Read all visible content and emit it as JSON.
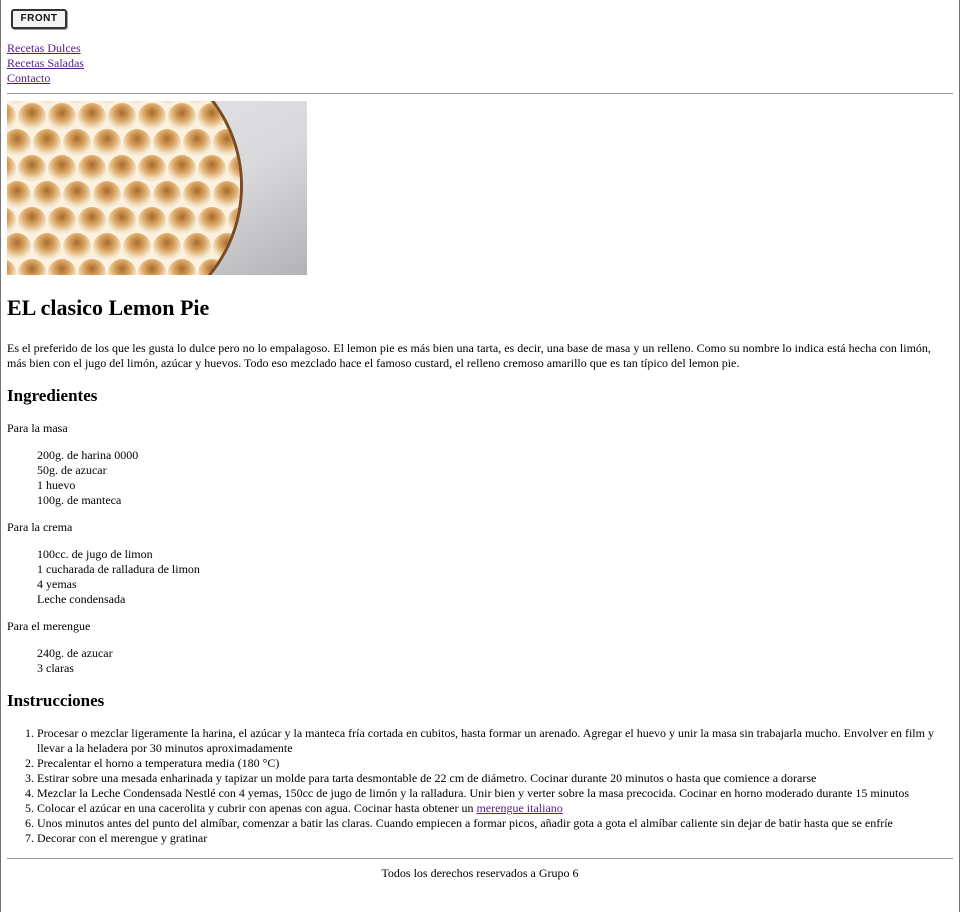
{
  "header": {
    "logo_text": "FRONT",
    "nav": [
      "Recetas Dulces",
      "Recetas Saladas",
      "Contacto"
    ]
  },
  "recipe": {
    "title": "EL clasico Lemon Pie",
    "intro": "Es el preferido de los que les gusta lo dulce pero no lo empalagoso. El lemon pie es más bien una tarta, es decir, una base de masa y un relleno. Como su nombre lo indica está hecha con limón, más bien con el jugo del limón, azúcar y huevos. Todo eso mezclado hace el famoso custard, el relleno cremoso amarillo que es tan típico del lemon pie.",
    "ingredients_heading": "Ingredientes",
    "groups": [
      {
        "title": "Para la masa",
        "items": [
          "200g. de harina 0000",
          "50g. de azucar",
          "1 huevo",
          "100g. de manteca"
        ]
      },
      {
        "title": "Para la crema",
        "items": [
          "100cc. de jugo de limon",
          "1 cucharada de ralladura de limon",
          "4 yemas",
          "Leche condensada"
        ]
      },
      {
        "title": "Para el merengue",
        "items": [
          "240g. de azucar",
          "3 claras"
        ]
      }
    ],
    "instructions_heading": "Instrucciones",
    "steps": [
      "Procesar o mezclar ligeramente la harina, el azúcar y la manteca fría cortada en cubitos, hasta formar un arenado. Agregar el huevo y unir la masa sin trabajarla mucho. Envolver en film y llevar a la heladera por 30 minutos aproximadamente",
      "Precalentar el horno a temperatura media (180 °C)",
      "Estirar sobre una mesada enharinada y tapizar un molde para tarta desmontable de 22 cm de diámetro. Cocinar durante 20 minutos o hasta que comience a dorarse",
      "Mezclar la Leche Condensada Nestlé con 4 yemas, 150cc de jugo de limón y la ralladura. Unir bien y verter sobre la masa precocida. Cocinar en horno moderado durante 15 minutos",
      "Unos minutos antes del punto del almíbar, comenzar a batir las claras. Cuando empiecen a formar picos, añadir gota a gota el almíbar caliente sin dejar de batir hasta que se enfríe",
      "Decorar con el merengue y gratinar"
    ],
    "step5": {
      "text": "Colocar el azúcar en una cacerolita y cubrir con apenas con agua. Cocinar hasta obtener un ",
      "link": "merengue italiano"
    }
  },
  "footer": {
    "text": "Todos los derechos reservados a Grupo 6"
  },
  "colors": {
    "link": "#551a8b",
    "rule": "#9a9a9a"
  }
}
